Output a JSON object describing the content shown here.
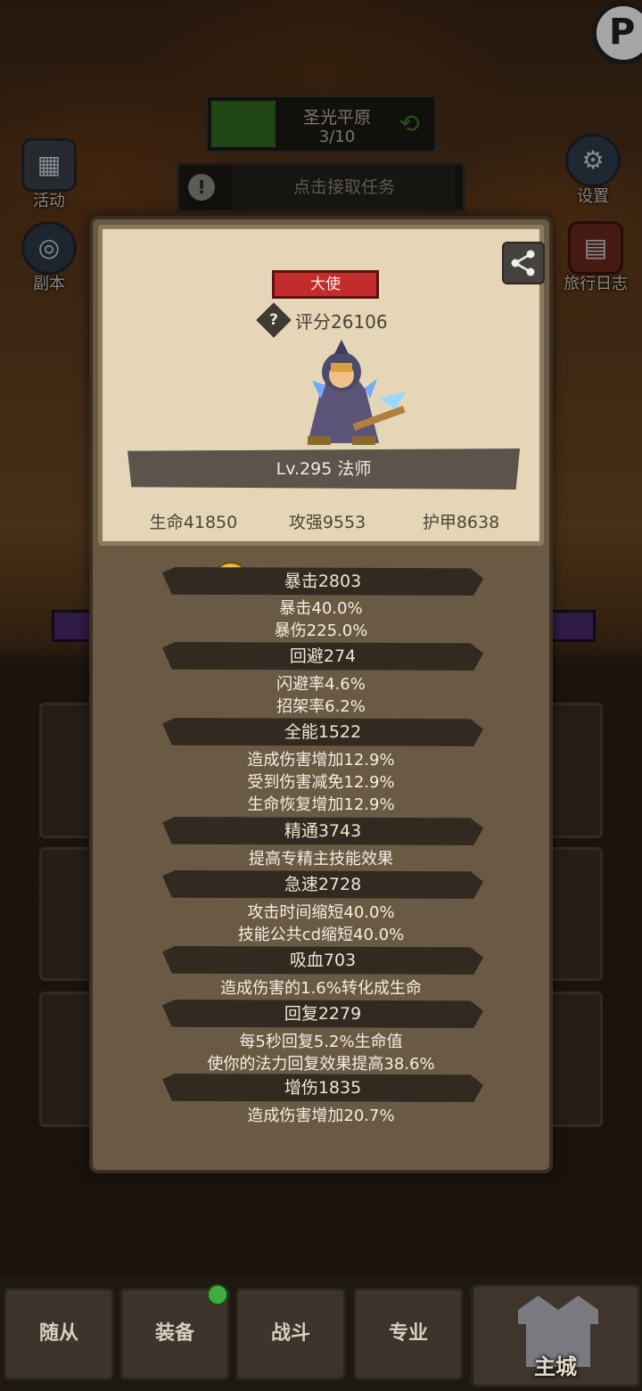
{
  "area": {
    "name": "圣光平原",
    "progress": "3/10"
  },
  "task": {
    "label": "点击接取任务"
  },
  "side_buttons": {
    "activity": "活动",
    "dungeon": "副本",
    "settings": "设置",
    "journal": "旅行日志"
  },
  "corner_badge": "P",
  "modal": {
    "title_badge": "大使",
    "score": "评分26106",
    "level": "Lv.295 法师",
    "stats": [
      "生命41850",
      "攻强9553",
      "护甲8638"
    ],
    "sections": [
      {
        "header": "暴击2803",
        "lines": [
          "暴击40.0%",
          "暴伤225.0%"
        ]
      },
      {
        "header": "回避274",
        "lines": [
          "闪避率4.6%",
          "招架率6.2%"
        ]
      },
      {
        "header": "全能1522",
        "lines": [
          "造成伤害增加12.9%",
          "受到伤害减免12.9%",
          "生命恢复增加12.9%"
        ]
      },
      {
        "header": "精通3743",
        "lines": [
          "提高专精主技能效果"
        ]
      },
      {
        "header": "急速2728",
        "lines": [
          "攻击时间缩短40.0%",
          "技能公共cd缩短40.0%"
        ]
      },
      {
        "header": "吸血703",
        "lines": [
          "造成伤害的1.6%转化成生命"
        ]
      },
      {
        "header": "回复2279",
        "lines": [
          "每5秒回复5.2%生命值",
          "使你的法力回复效果提高38.6%"
        ]
      },
      {
        "header": "增伤1835",
        "lines": [
          "造成伤害增加20.7%"
        ]
      }
    ]
  },
  "bottom_nav": [
    "随从",
    "装备",
    "战斗",
    "专业"
  ],
  "castle": "主城",
  "colors": {
    "title_badge": "#c22c2c",
    "area_green": "#2f6a1c",
    "notify_dot": "#3fae3f"
  }
}
